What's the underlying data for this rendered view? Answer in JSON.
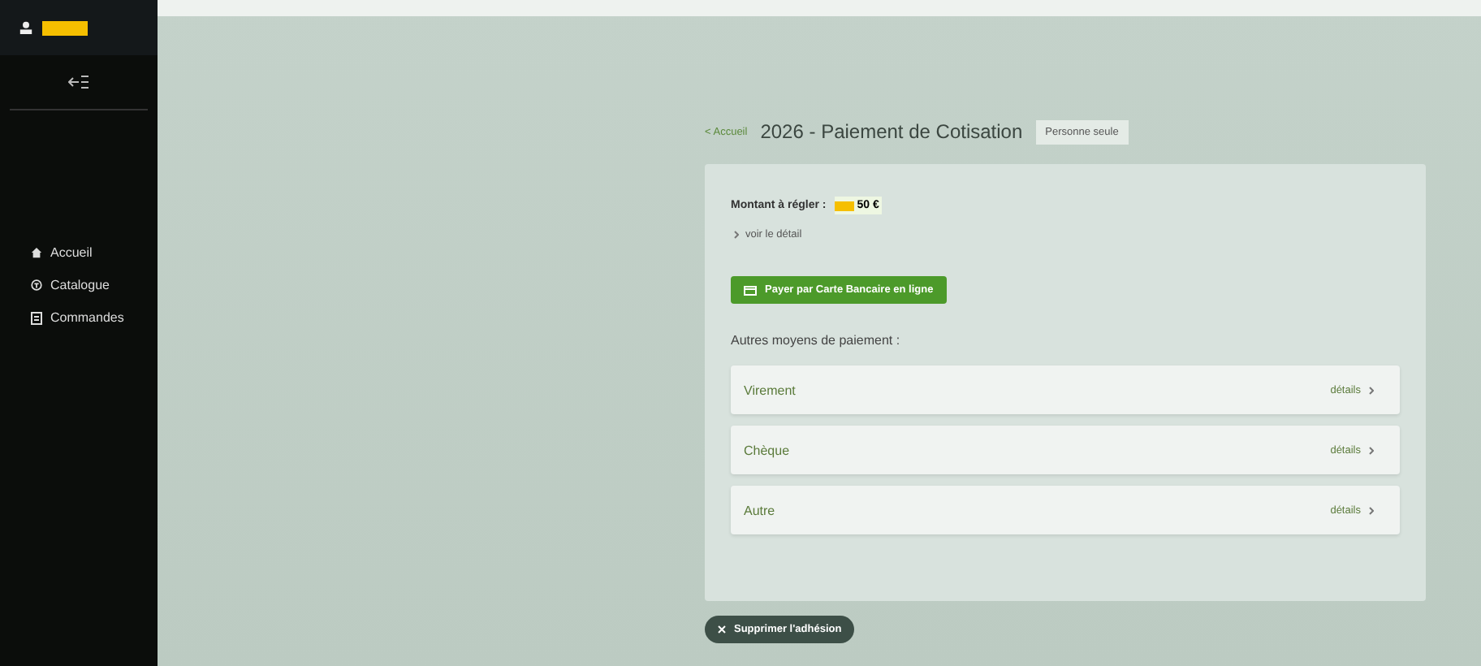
{
  "sidebar": {
    "items": [
      {
        "label": "Accueil"
      },
      {
        "label": "Catalogue"
      },
      {
        "label": "Commandes"
      }
    ]
  },
  "header": {
    "back_link": "< Accueil",
    "title": "2026 - Paiement de Cotisation",
    "badge": "Personne seule"
  },
  "card": {
    "amount_label": "Montant à régler :",
    "amount": "50 €",
    "detail_link": "voir le détail",
    "pay_button": "Payer par Carte Bancaire en ligne",
    "other_heading": "Autres moyens de paiement :",
    "methods": [
      {
        "label": "Virement",
        "action": "détails"
      },
      {
        "label": "Chèque",
        "action": "détails"
      },
      {
        "label": "Autre",
        "action": "détails"
      }
    ]
  },
  "delete_button": "Supprimer l'adhésion"
}
